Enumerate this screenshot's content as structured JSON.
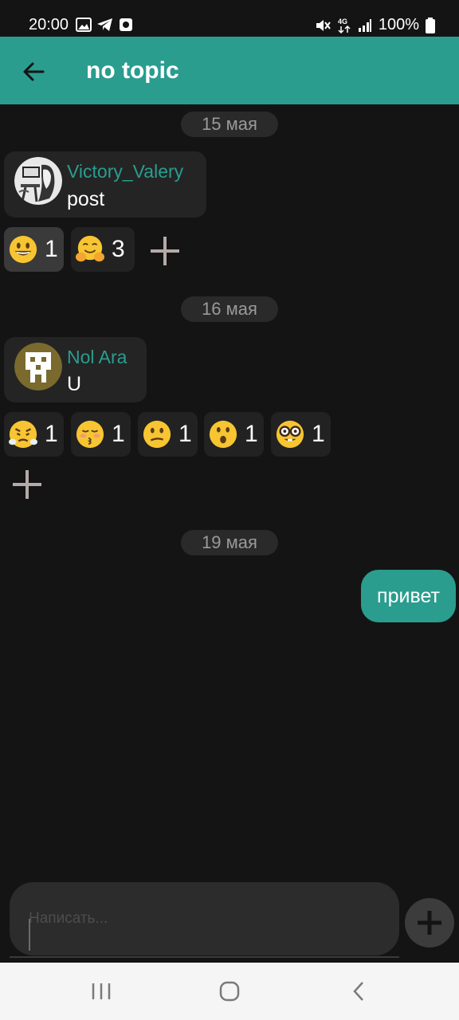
{
  "status_bar": {
    "time": "20:00",
    "battery": "100%",
    "icons": [
      "image-icon",
      "telegram-icon",
      "app-notification-icon",
      "mute-icon",
      "network-4g-icon",
      "signal-icon",
      "battery-icon"
    ]
  },
  "header": {
    "title": "no topic",
    "back_icon": "arrow-left-icon"
  },
  "messages": [
    {
      "date": "15 мая",
      "sender": "Victory_Valery",
      "text": "post",
      "reactions": [
        {
          "emoji": "grinning-face",
          "count": "1",
          "selected": true
        },
        {
          "emoji": "hugging-face",
          "count": "3",
          "selected": false
        }
      ]
    },
    {
      "date": "16 мая",
      "sender": "Nol Ara",
      "text": "U",
      "reactions": [
        {
          "emoji": "face-with-steam",
          "count": "1",
          "selected": false
        },
        {
          "emoji": "kissing-face",
          "count": "1",
          "selected": false
        },
        {
          "emoji": "confused-face",
          "count": "1",
          "selected": false
        },
        {
          "emoji": "hushed-face",
          "count": "1",
          "selected": false
        },
        {
          "emoji": "nerd-face",
          "count": "1",
          "selected": false
        }
      ]
    },
    {
      "date": "19 мая",
      "own_text": "привет"
    }
  ],
  "composer": {
    "placeholder": "Написать...",
    "value": ""
  },
  "colors": {
    "accent": "#2a9d8f",
    "background": "#141414",
    "bubble": "#242424",
    "date_chip": "#2a2a2a",
    "nav_bar": "#f5f5f5"
  }
}
